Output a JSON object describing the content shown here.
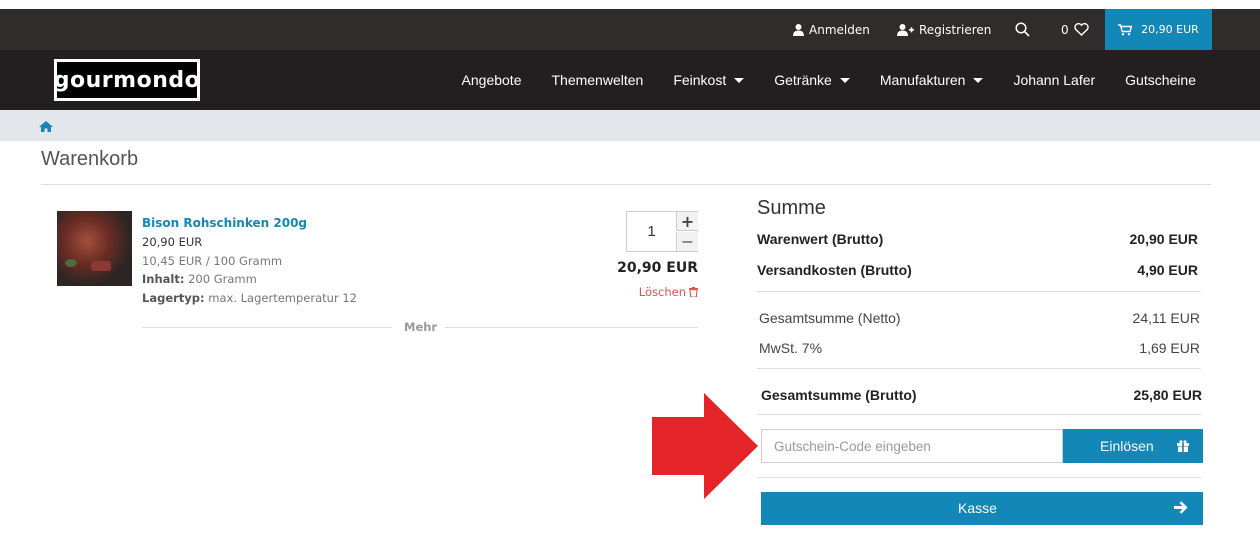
{
  "colors": {
    "accent": "#1387b7",
    "topbar": "#2f2c2b",
    "navbar": "#231f20",
    "arrow": "#e5242a",
    "delete": "#d9534f"
  },
  "topbar": {
    "login": "Anmelden",
    "register": "Registrieren",
    "wishlist_count": "0",
    "cart_total": "20,90 EUR"
  },
  "brand": {
    "logo_text": "gourmondo"
  },
  "nav": {
    "items": [
      "Angebote",
      "Themenwelten",
      "Feinkost",
      "Getränke",
      "Manufakturen",
      "Johann Lafer",
      "Gutscheine"
    ]
  },
  "page": {
    "title": "Warenkorb"
  },
  "product": {
    "name": "Bison Rohschinken 200g",
    "price": "20,90 EUR",
    "unit_price": "10,45 EUR / 100 Gramm",
    "content_label": "Inhalt:",
    "content_value": "200 Gramm",
    "storage_label": "Lagertyp:",
    "storage_value": "max. Lagertemperatur 12",
    "quantity": "1",
    "plus": "+",
    "minus": "−",
    "line_total": "20,90 EUR",
    "delete_label": "Löschen",
    "more_label": "Mehr"
  },
  "summary": {
    "title": "Summe",
    "rows": [
      {
        "label": "Warenwert (Brutto)",
        "value": "20,90 EUR"
      },
      {
        "label": "Versandkosten (Brutto)",
        "value": "4,90 EUR"
      },
      {
        "label": "Gesamtsumme (Netto)",
        "value": "24,11 EUR"
      },
      {
        "label": "MwSt. 7%",
        "value": "1,69 EUR"
      },
      {
        "label": "Gesamtsumme (Brutto)",
        "value": "25,80 EUR"
      }
    ],
    "coupon_placeholder": "Gutschein-Code eingeben",
    "redeem_label": "Einlösen",
    "checkout_label": "Kasse"
  },
  "icons": [
    "user-icon",
    "user-plus-icon",
    "search-icon",
    "heart-icon",
    "cart-icon",
    "home-icon",
    "trash-icon",
    "gift-icon",
    "arrow-right-icon"
  ]
}
